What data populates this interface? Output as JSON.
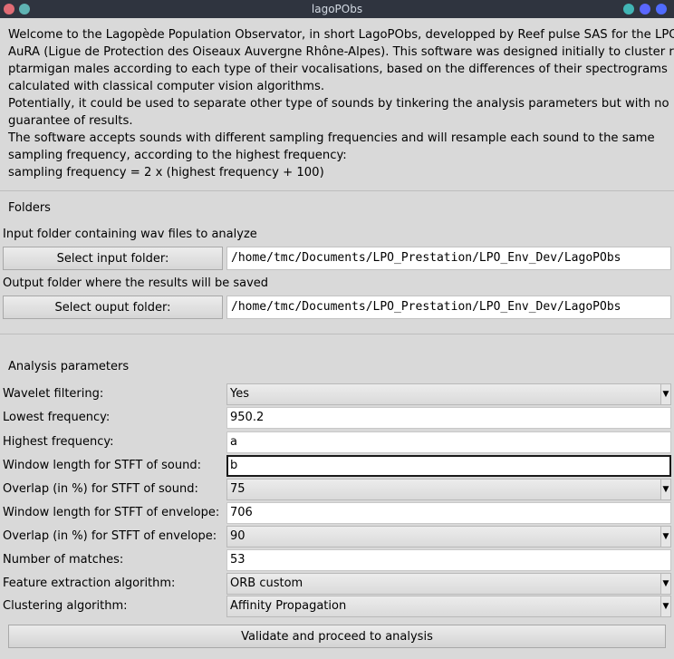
{
  "window": {
    "title": "lagoPObs",
    "left_dot_colors": [
      "#e06c75",
      "#5fb3b3"
    ],
    "right_dot_colors": [
      "#5fb3b3",
      "#5a67ff",
      "#4f6bff"
    ]
  },
  "intro": {
    "lines": [
      "Welcome to the Lagopède Population Observator, in short LagoPObs, developped by Reef pulse SAS for the LPO",
      "AuRA (Ligue de Protection des Oiseaux Auvergne Rhône-Alpes). This software was designed initially to cluster rock",
      "ptarmigan males according to each type of their vocalisations, based on the differences of their spectrograms",
      "calculated with classical computer vision algorithms.",
      "Potentially, it could be used to separate other type of sounds by tinkering the analysis parameters but with no",
      "guarantee of results.",
      "The software accepts sounds with different sampling frequencies and will resample each sound to the same",
      "sampling frequency, according to the highest frequency:",
      "sampling frequency = 2 x (highest frequency + 100)"
    ]
  },
  "folders": {
    "title": "Folders",
    "input_label": "Input folder containing wav files to analyze",
    "input_button": "Select input folder:",
    "input_path": "/home/tmc/Documents/LPO_Prestation/LPO_Env_Dev/LagoPObs",
    "output_label": "Output folder where the results will be saved",
    "output_button": "Select ouput folder:",
    "output_path": "/home/tmc/Documents/LPO_Prestation/LPO_Env_Dev/LagoPObs"
  },
  "analysis": {
    "title": "Analysis parameters",
    "params": [
      {
        "label": "Wavelet filtering:",
        "value": "Yes"
      },
      {
        "label": "Lowest frequency:",
        "value": "950.2"
      },
      {
        "label": "Highest frequency:",
        "value": "a"
      },
      {
        "label": "Window length for STFT of sound:",
        "value": "b"
      },
      {
        "label": "Overlap (in %) for STFT of sound:",
        "value": "75"
      },
      {
        "label": "Window length for STFT of envelope:",
        "value": "706"
      },
      {
        "label": "Overlap (in %) for STFT of envelope:",
        "value": "90"
      },
      {
        "label": "Number of matches:",
        "value": "53"
      },
      {
        "label": "Feature extraction algorithm:",
        "value": "ORB custom"
      },
      {
        "label": "Clustering algorithm:",
        "value": "Affinity Propagation"
      }
    ]
  },
  "validate_label": "Validate and proceed to analysis"
}
